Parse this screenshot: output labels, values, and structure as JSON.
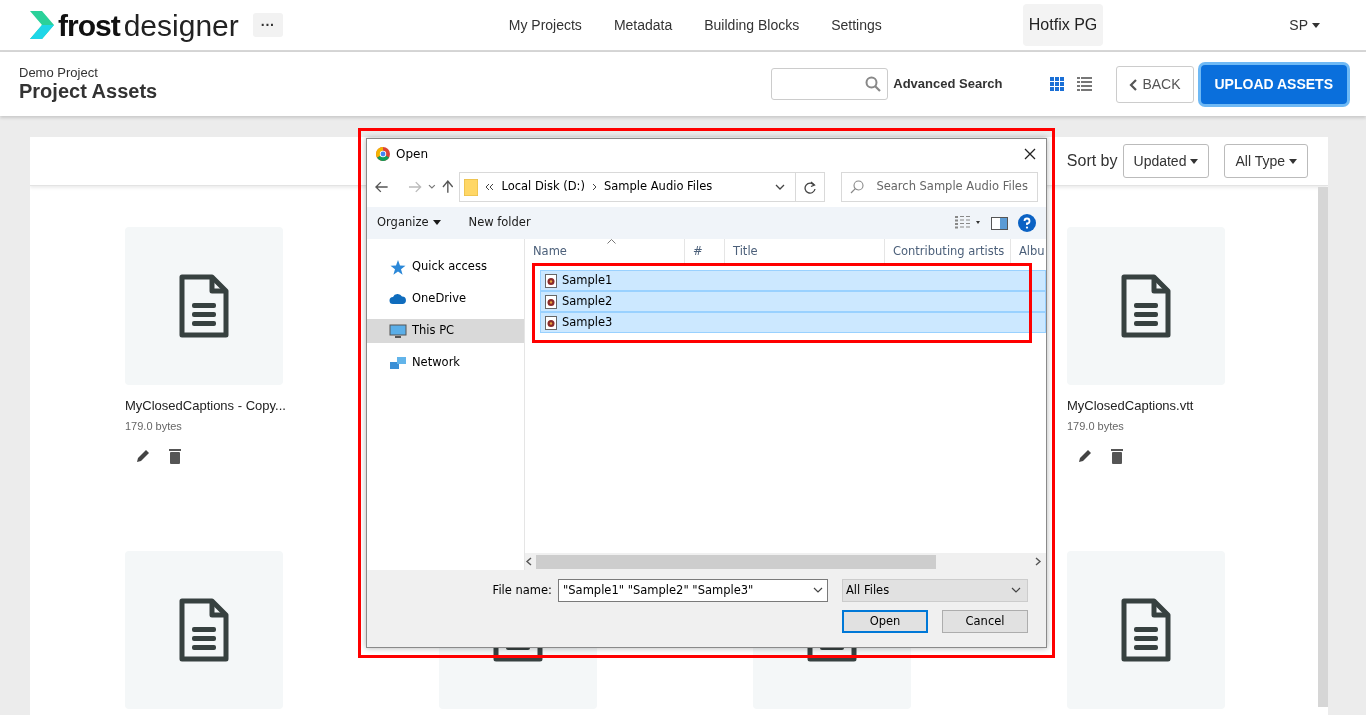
{
  "app": {
    "logo_bold": "frost",
    "logo_light": "designer",
    "more": "···"
  },
  "nav": [
    {
      "label": "My Projects"
    },
    {
      "label": "Metadata"
    },
    {
      "label": "Building Blocks"
    },
    {
      "label": "Settings"
    }
  ],
  "workspace": "Hotfix PG",
  "user": "SP",
  "header": {
    "breadcrumb": "Demo Project",
    "title": "Project Assets",
    "advanced_search": "Advanced Search",
    "views": [
      {
        "kind": "grid",
        "selected": true
      },
      {
        "kind": "list",
        "selected": false
      }
    ],
    "back": "BACK",
    "upload": "UPLOAD ASSETS"
  },
  "toolbar": {
    "sort_label": "Sort by",
    "sort": "Updated",
    "type_filter": "All Type"
  },
  "assets": [
    {
      "kind": "file",
      "name": "MyClosedCaptions - Copy...",
      "size": "179.0 bytes"
    },
    {
      "kind": "gap"
    },
    {
      "kind": "gap"
    },
    {
      "kind": "file",
      "name": "MyClosedCaptions.vtt",
      "size": "179.0 bytes"
    },
    {
      "kind": "thumb"
    },
    {
      "kind": "thumb"
    },
    {
      "kind": "thumb"
    },
    {
      "kind": "thumb"
    }
  ],
  "dialog": {
    "title": "Open",
    "path": [
      "Local Disk (D:)",
      "Sample Audio Files"
    ],
    "search_placeholder": "Search Sample Audio Files",
    "organize": "Organize",
    "new_folder": "New folder",
    "nav_items": [
      {
        "label": "Quick access",
        "kind": "star",
        "selected": false
      },
      {
        "label": "OneDrive",
        "kind": "cloud",
        "selected": false
      },
      {
        "label": "This PC",
        "kind": "pc",
        "selected": true
      },
      {
        "label": "Network",
        "kind": "network",
        "selected": false
      }
    ],
    "columns": [
      "Name",
      "#",
      "Title",
      "Contributing artists",
      "Albu"
    ],
    "files": [
      {
        "name": "Sample1",
        "selected": true
      },
      {
        "name": "Sample2",
        "selected": true
      },
      {
        "name": "Sample3",
        "selected": true
      }
    ],
    "file_name_label": "File name:",
    "file_name": "\"Sample1\" \"Sample2\" \"Sample3\"",
    "file_type": "All Files",
    "open": "Open",
    "cancel": "Cancel"
  }
}
